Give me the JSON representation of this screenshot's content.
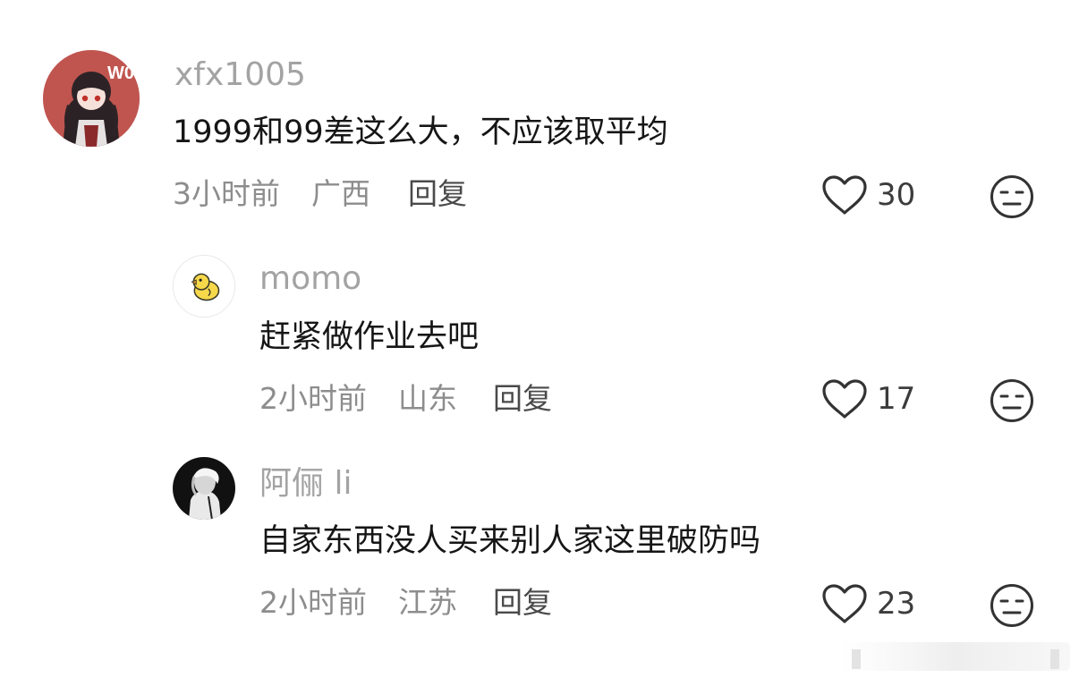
{
  "comments": [
    {
      "username": "xfx1005",
      "content": "1999和99差这么大，不应该取平均",
      "time": "3小时前",
      "location": "广西",
      "reply_label": "回复",
      "likes": "30",
      "avatar_icon": "anime-character-avatar-icon"
    },
    {
      "username": "momo",
      "content": "赶紧做作业去吧",
      "time": "2小时前",
      "location": "山东",
      "reply_label": "回复",
      "likes": "17",
      "avatar_icon": "yellow-duck-avatar-icon"
    },
    {
      "username": "阿俪 li",
      "content": "自家东西没人买来别人家这里破防吗",
      "time": "2小时前",
      "location": "江苏",
      "reply_label": "回复",
      "likes": "23",
      "avatar_icon": "dark-portrait-avatar-icon"
    }
  ],
  "icons": {
    "like": "heart-outline-icon",
    "dislike": "unimpressed-face-icon"
  },
  "colors": {
    "username": "#a3a3a3",
    "content": "#161616",
    "meta": "#8d8d8d",
    "reply": "#4a4a4a",
    "icon_stroke": "#333333"
  }
}
